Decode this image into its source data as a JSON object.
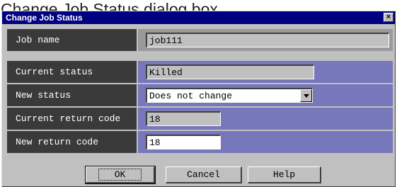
{
  "caption": "Change Job Status dialog box",
  "window": {
    "title": "Change Job Status",
    "close_glyph": "×"
  },
  "rows": [
    {
      "label": "Job name",
      "value": "job111"
    },
    {
      "label": "Current status",
      "value": "Killed"
    },
    {
      "label": "New status",
      "value": "Does not change"
    },
    {
      "label": "Current return code",
      "value": "18"
    },
    {
      "label": "New return code",
      "value": "18"
    }
  ],
  "buttons": {
    "ok": "OK",
    "cancel": "Cancel",
    "help": "Help"
  },
  "colors": {
    "titlebar": "#000080",
    "label_bg": "#3a3a3a",
    "value_bg": "#7777bb",
    "dialog_bg": "#c0c0c0"
  }
}
